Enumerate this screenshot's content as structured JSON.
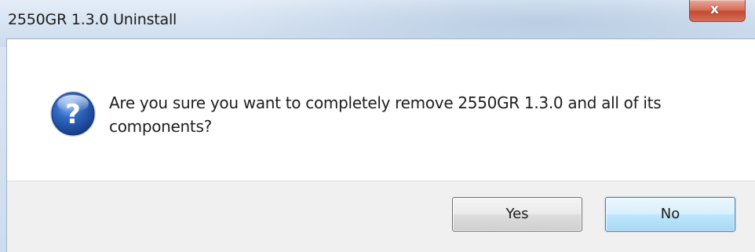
{
  "window": {
    "title": "2550GR 1.3.0 Uninstall",
    "close_glyph": "x"
  },
  "dialog": {
    "icon": "question-icon",
    "message": "Are you sure you want to completely remove 2550GR 1.3.0 and all of its components?"
  },
  "buttons": {
    "yes_label": "Yes",
    "no_label": "No"
  },
  "colors": {
    "title_bar": "#d5e2f1",
    "close_button": "#c44a32",
    "client_background": "#ffffff",
    "button_panel": "#f0f0f0",
    "focused_button_border": "#3c7fb1",
    "question_icon": "#2c5fb4"
  }
}
